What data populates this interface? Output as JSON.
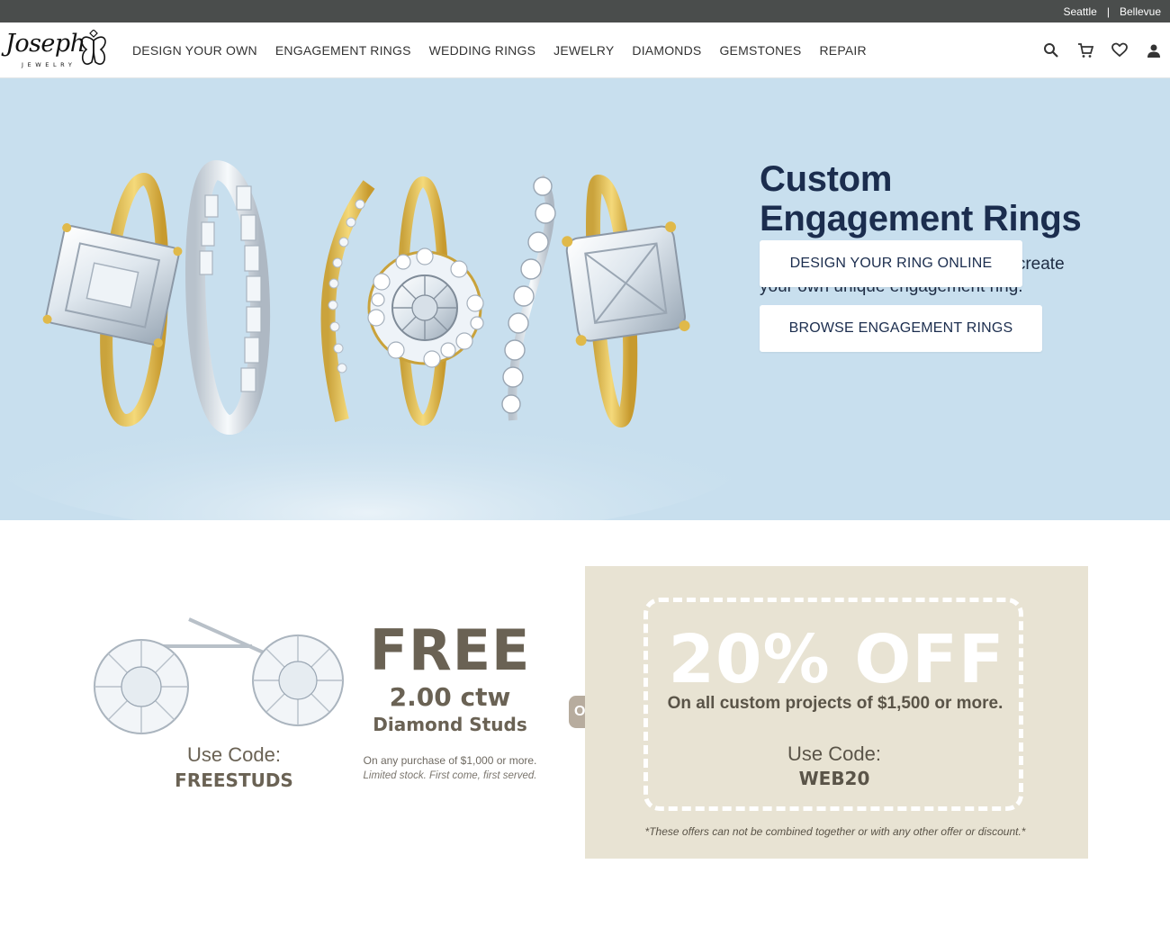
{
  "topbar": {
    "locations": [
      "Seattle",
      "Bellevue"
    ],
    "separator": "|"
  },
  "brand": {
    "name": "Joseph",
    "subtitle": "JEWELRY"
  },
  "nav": {
    "items": [
      "DESIGN YOUR OWN",
      "ENGAGEMENT RINGS",
      "WEDDING RINGS",
      "JEWELRY",
      "DIAMONDS",
      "GEMSTONES",
      "REPAIR"
    ]
  },
  "header_icons": [
    "search-icon",
    "cart-icon",
    "heart-icon",
    "user-icon"
  ],
  "hero": {
    "title_line1": "Custom",
    "title_line2": "Engagement Rings",
    "text": "Work online with our designers to create your own unique engagement ring.",
    "button_primary": "DESIGN YOUR RING ONLINE",
    "button_secondary": "BROWSE ENGAGEMENT RINGS"
  },
  "promo_free": {
    "headline": "FREE",
    "carat": "2.00 ctw",
    "product": "Diamond Studs",
    "code_label": "Use Code:",
    "code": "FREESTUDS",
    "note": "On any purchase of $1,000 or more.",
    "note2": "Limited stock. First come, first served."
  },
  "or_label": "OR",
  "promo_off": {
    "headline": "20% OFF",
    "subtext": "On all custom projects of $1,500 or more.",
    "code_label": "Use Code:",
    "code": "WEB20",
    "disclaimer": "*These offers can not be combined together or with any other offer or discount.*"
  },
  "colors": {
    "topbar": "#4a4d4c",
    "hero_bg": "#c8dfee",
    "title": "#1b2d4e",
    "promo_bg": "#e8e3d3",
    "promo_text": "#6a6254",
    "gold": "#e0b94a"
  }
}
